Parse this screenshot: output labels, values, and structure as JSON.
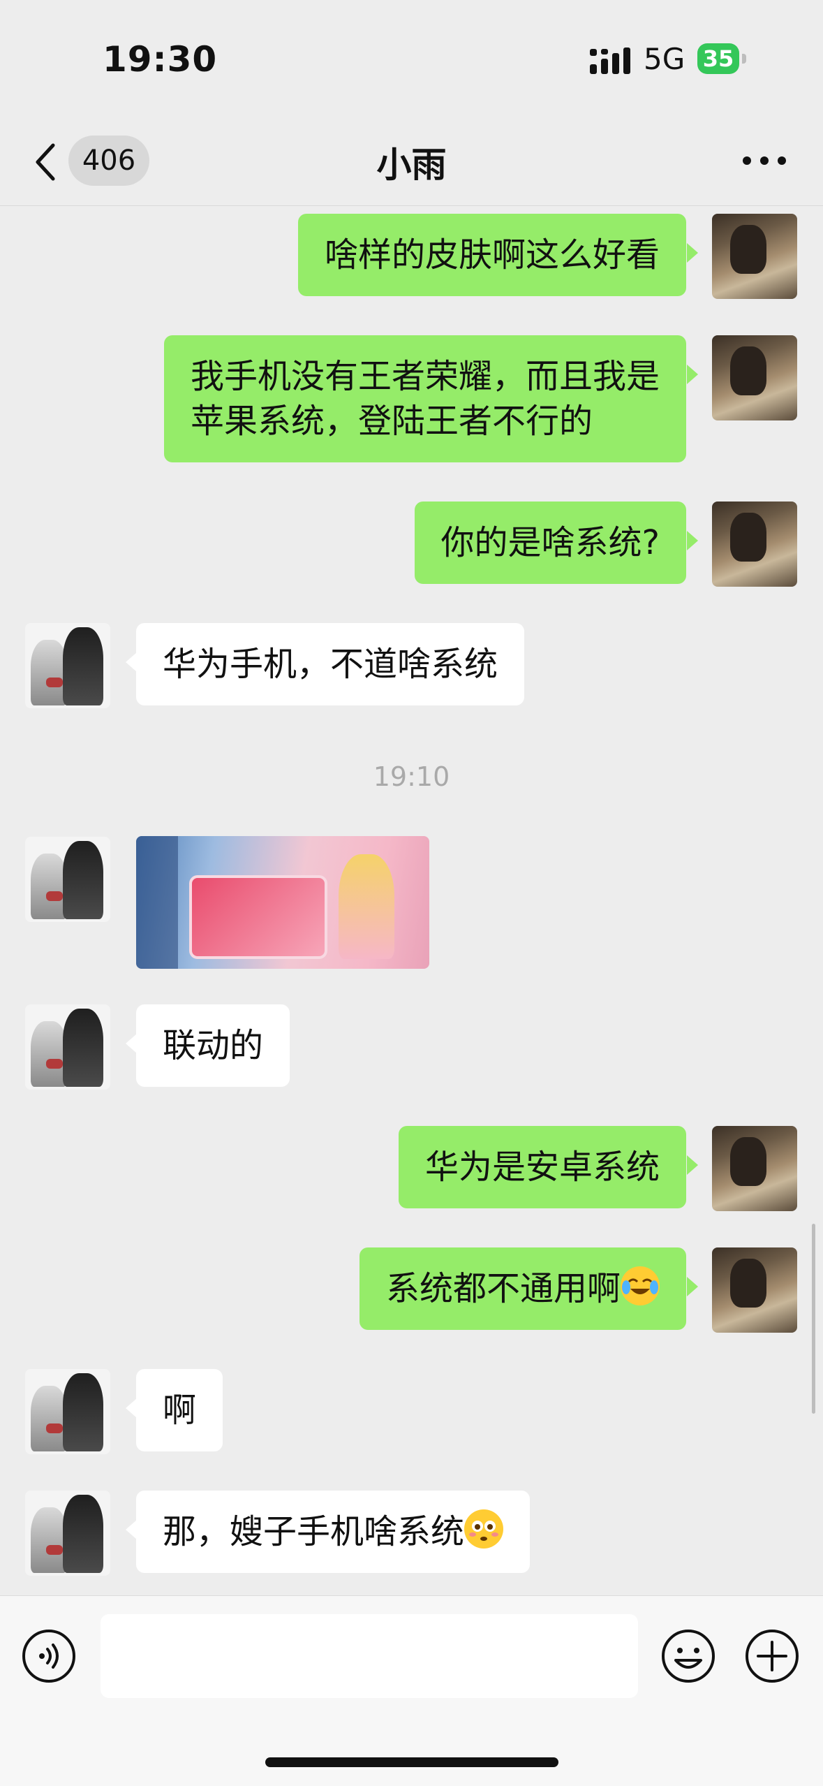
{
  "status_bar": {
    "time": "19:30",
    "network": "5G",
    "battery": "35"
  },
  "nav": {
    "unread_count": "406",
    "contact_name": "小雨"
  },
  "messages": [
    {
      "from": "me",
      "text": "啥样的皮肤啊这么好看"
    },
    {
      "from": "me",
      "lines": [
        "我手机没有王者荣耀，而且我是",
        "苹果系统，登陆王者不行的"
      ]
    },
    {
      "from": "me",
      "text": "你的是啥系统?"
    },
    {
      "from": "other",
      "text": "华为手机，不道啥系统"
    },
    {
      "timestamp": "19:10"
    },
    {
      "from": "other",
      "type": "image",
      "icon": "game-promo-image"
    },
    {
      "from": "other",
      "text": "联动的"
    },
    {
      "from": "me",
      "text": "华为是安卓系统"
    },
    {
      "from": "me",
      "text": "系统都不通用啊",
      "emoji": "crying-laughing-emoji"
    },
    {
      "from": "other",
      "text": "啊"
    },
    {
      "from": "other",
      "text": "那，嫂子手机啥系统",
      "emoji": "flushed-emoji"
    }
  ],
  "input_bar": {
    "placeholder": ""
  },
  "colors": {
    "my_bubble": "#95ec69",
    "their_bubble": "#ffffff",
    "background": "#ededed",
    "battery": "#34c759"
  },
  "icons": [
    "back-arrow-icon",
    "more-icon",
    "voice-icon",
    "emoji-icon",
    "plus-icon",
    "signal-icon",
    "battery-icon"
  ]
}
